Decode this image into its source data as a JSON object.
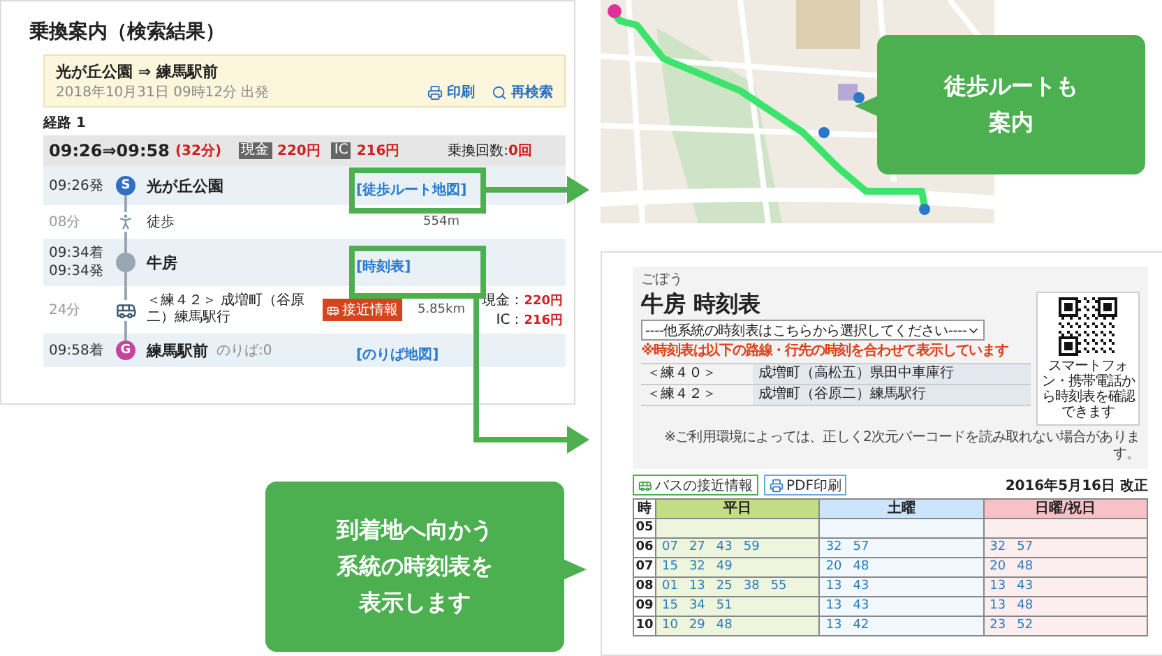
{
  "route_panel": {
    "title": "乗換案内（検索結果）",
    "header": {
      "route": "光が丘公園 ⇒ 練馬駅前",
      "departure": "2018年10月31日 09時12分 出発",
      "actions": [
        {
          "kind": "print",
          "label": "印刷"
        },
        {
          "kind": "search",
          "label": "再検索"
        }
      ]
    },
    "route_label": "経路 1",
    "summary": {
      "times": "09:26⇒09:58",
      "duration": "(32分)",
      "fares": [
        {
          "badge": "現金",
          "amount": "220円"
        },
        {
          "badge": "IC",
          "amount": "216円"
        }
      ],
      "transfers_label": "乗換回数:",
      "transfers": "0回"
    },
    "steps": [
      {
        "kind": "stop",
        "times": [
          "09:26発"
        ],
        "marker": "S",
        "color": "#2f6fc4",
        "name": "光が丘公園",
        "link": "[徒歩ルート地図]"
      },
      {
        "kind": "walk",
        "time": "08分",
        "mode": "徒歩",
        "distance": "554m"
      },
      {
        "kind": "stop",
        "times": [
          "09:34着",
          "09:34発"
        ],
        "color": "#9aa7b2",
        "name": "牛房",
        "link": "[時刻表]"
      },
      {
        "kind": "bus",
        "time": "24分",
        "line": "＜練４２＞ 成増町（谷原二）練馬駅行",
        "badge": "接近情報",
        "distance": "5.85km",
        "fares": [
          {
            "label": "現金：",
            "amount": "220円"
          },
          {
            "label": "IC：",
            "amount": "216円"
          }
        ]
      },
      {
        "kind": "stop",
        "times": [
          "09:58着"
        ],
        "marker": "G",
        "color": "#c8449c",
        "name": "練馬駅前",
        "platform": "のりば:0",
        "link": "[のりば地図]"
      }
    ]
  },
  "callouts": [
    {
      "lines": [
        "徒歩ルートも",
        "案内"
      ]
    },
    {
      "lines": [
        "到着地へ向かう",
        "系統の時刻表を",
        "表示します"
      ]
    }
  ],
  "timetable": {
    "reading": "ごぼう",
    "title": "牛房 時刻表",
    "select": {
      "value": "----他系統の時刻表はこちらから選択してください----"
    },
    "notice": "※時刻表は以下の路線・行先の時刻を合わせて表示しています",
    "routes": [
      {
        "line": "＜練４０＞",
        "destination": "成増町（高松五）県田中車庫行"
      },
      {
        "line": "＜練４２＞",
        "destination": "成増町（谷原二）練馬駅行"
      }
    ],
    "qr_caption": "スマートフォン・携帯電話から時刻表を確認できます",
    "qr_note": "※ご利用環境によっては、正しく2次元バーコードを読み取れない場合があります。",
    "buttons": [
      {
        "kind": "bus",
        "label": "バスの接近情報"
      },
      {
        "kind": "print",
        "label": "PDF印刷"
      }
    ],
    "revision": "2016年5月16日 改正",
    "hour_label": "時",
    "columns": [
      {
        "label": "平日",
        "color": "#c3dd87"
      },
      {
        "label": "土曜",
        "color": "#cde5fb"
      },
      {
        "label": "日曜/祝日",
        "color": "#f6c1c7"
      }
    ],
    "rows": [
      {
        "hour": "05"
      },
      {
        "hour": "06",
        "cells": [
          [
            "07",
            "27",
            "43",
            "59"
          ],
          [
            "32",
            "57"
          ],
          [
            "32",
            "57"
          ]
        ]
      },
      {
        "hour": "07",
        "cells": [
          [
            "15",
            "32",
            "49"
          ],
          [
            "20",
            "48"
          ],
          [
            "20",
            "48"
          ]
        ]
      },
      {
        "hour": "08",
        "cells": [
          [
            "01",
            "13",
            "25",
            "38",
            "55"
          ],
          [
            "13",
            "43"
          ],
          [
            "13",
            "43"
          ]
        ]
      },
      {
        "hour": "09",
        "cells": [
          [
            "15",
            "34",
            "51"
          ],
          [
            "13",
            "43"
          ],
          [
            "13",
            "48"
          ]
        ]
      },
      {
        "hour": "10",
        "cells": [
          [
            "10",
            "29",
            "48"
          ],
          [
            "13",
            "42"
          ],
          [
            "23",
            "52"
          ]
        ]
      }
    ]
  }
}
